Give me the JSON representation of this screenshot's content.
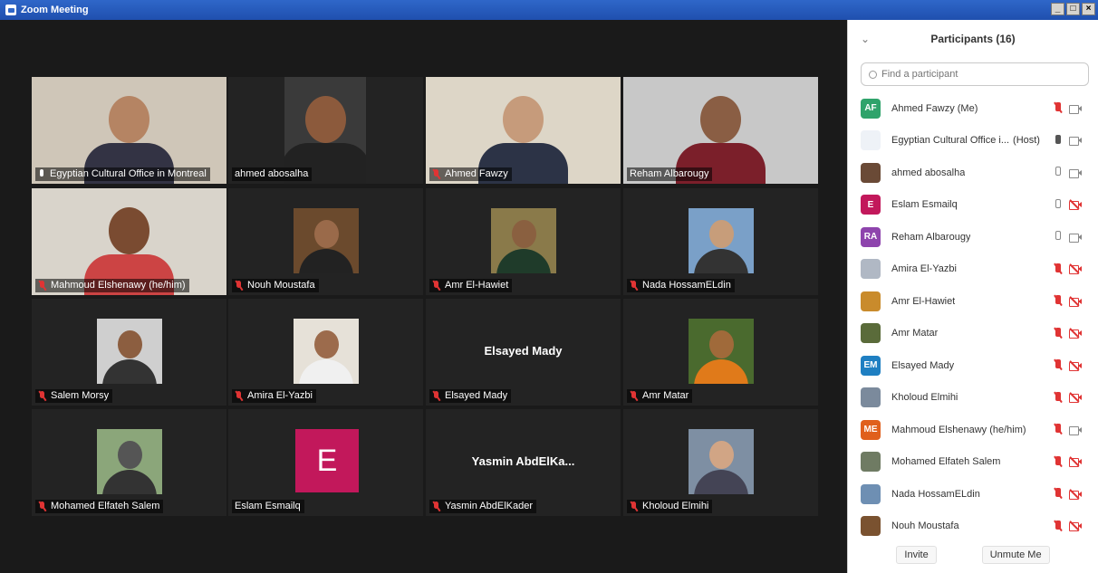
{
  "window": {
    "title": "Zoom Meeting"
  },
  "colors": {
    "active_speaker_border": "#b8e05a",
    "muted_red": "#e03434",
    "title_bar": "#2f67c9"
  },
  "tiles": [
    {
      "name": "Egyptian Cultural Office in Montreal",
      "mic": "active",
      "active_speaker": true
    },
    {
      "name": "ahmed abosalha",
      "mic": "none"
    },
    {
      "name": "Ahmed Fawzy",
      "mic": "muted"
    },
    {
      "name": "Reham Albarougy",
      "mic": "none"
    },
    {
      "name": "Mahmoud Elshenawy (he/him)",
      "mic": "muted"
    },
    {
      "name": "Nouh Moustafa",
      "mic": "muted"
    },
    {
      "name": "Amr El-Hawiet",
      "mic": "muted"
    },
    {
      "name": "Nada HossamELdin",
      "mic": "muted"
    },
    {
      "name": "Salem Morsy",
      "mic": "muted"
    },
    {
      "name": "Amira El-Yazbi",
      "mic": "muted"
    },
    {
      "name": "Elsayed Mady",
      "mic": "muted",
      "center_text": "Elsayed Mady"
    },
    {
      "name": "Amr Matar",
      "mic": "muted"
    },
    {
      "name": "Mohamed Elfateh Salem",
      "mic": "muted"
    },
    {
      "name": "Eslam Esmailq",
      "mic": "none",
      "avatar_letter": "E"
    },
    {
      "name": "Yasmin AbdElKader",
      "mic": "muted",
      "center_text": "Yasmin  AbdElKa..."
    },
    {
      "name": "Kholoud Elmihi",
      "mic": "muted"
    }
  ],
  "participants_panel": {
    "title": "Participants (16)",
    "search_placeholder": "Find a participant",
    "participants": [
      {
        "name": "Ahmed Fawzy (Me)",
        "initials": "AF",
        "avatar_color": "#2fa36b",
        "mic": "muted",
        "cam": "on"
      },
      {
        "name": "Egyptian Cultural Office i...",
        "tag": "(Host)",
        "initials": "",
        "avatar_color": "#eef2f7",
        "mic": "active",
        "cam": "on"
      },
      {
        "name": "ahmed abosalha",
        "initials": "",
        "avatar_color": "#6a4a36",
        "mic": "on",
        "cam": "on"
      },
      {
        "name": "Eslam Esmailq",
        "initials": "E",
        "avatar_color": "#c2185b",
        "mic": "on",
        "cam": "off"
      },
      {
        "name": "Reham Albarougy",
        "initials": "RA",
        "avatar_color": "#8e44ad",
        "mic": "on",
        "cam": "on"
      },
      {
        "name": "Amira El-Yazbi",
        "initials": "",
        "avatar_color": "#b0b8c4",
        "mic": "muted",
        "cam": "off"
      },
      {
        "name": "Amr El-Hawiet",
        "initials": "",
        "avatar_color": "#c98b2c",
        "mic": "muted",
        "cam": "off"
      },
      {
        "name": "Amr Matar",
        "initials": "",
        "avatar_color": "#5a6b3a",
        "mic": "muted",
        "cam": "off"
      },
      {
        "name": "Elsayed Mady",
        "initials": "EM",
        "avatar_color": "#1f7fc2",
        "mic": "muted",
        "cam": "off"
      },
      {
        "name": "Kholoud Elmihi",
        "initials": "",
        "avatar_color": "#7b8a9c",
        "mic": "muted",
        "cam": "off"
      },
      {
        "name": "Mahmoud Elshenawy (he/him)",
        "initials": "ME",
        "avatar_color": "#e0601c",
        "mic": "muted",
        "cam": "on"
      },
      {
        "name": "Mohamed Elfateh Salem",
        "initials": "",
        "avatar_color": "#6f7b63",
        "mic": "muted",
        "cam": "off"
      },
      {
        "name": "Nada HossamELdin",
        "initials": "",
        "avatar_color": "#6e8fb3",
        "mic": "muted",
        "cam": "off"
      },
      {
        "name": "Nouh Moustafa",
        "initials": "",
        "avatar_color": "#7a5230",
        "mic": "muted",
        "cam": "off"
      }
    ],
    "invite_label": "Invite",
    "unmute_label": "Unmute Me"
  }
}
